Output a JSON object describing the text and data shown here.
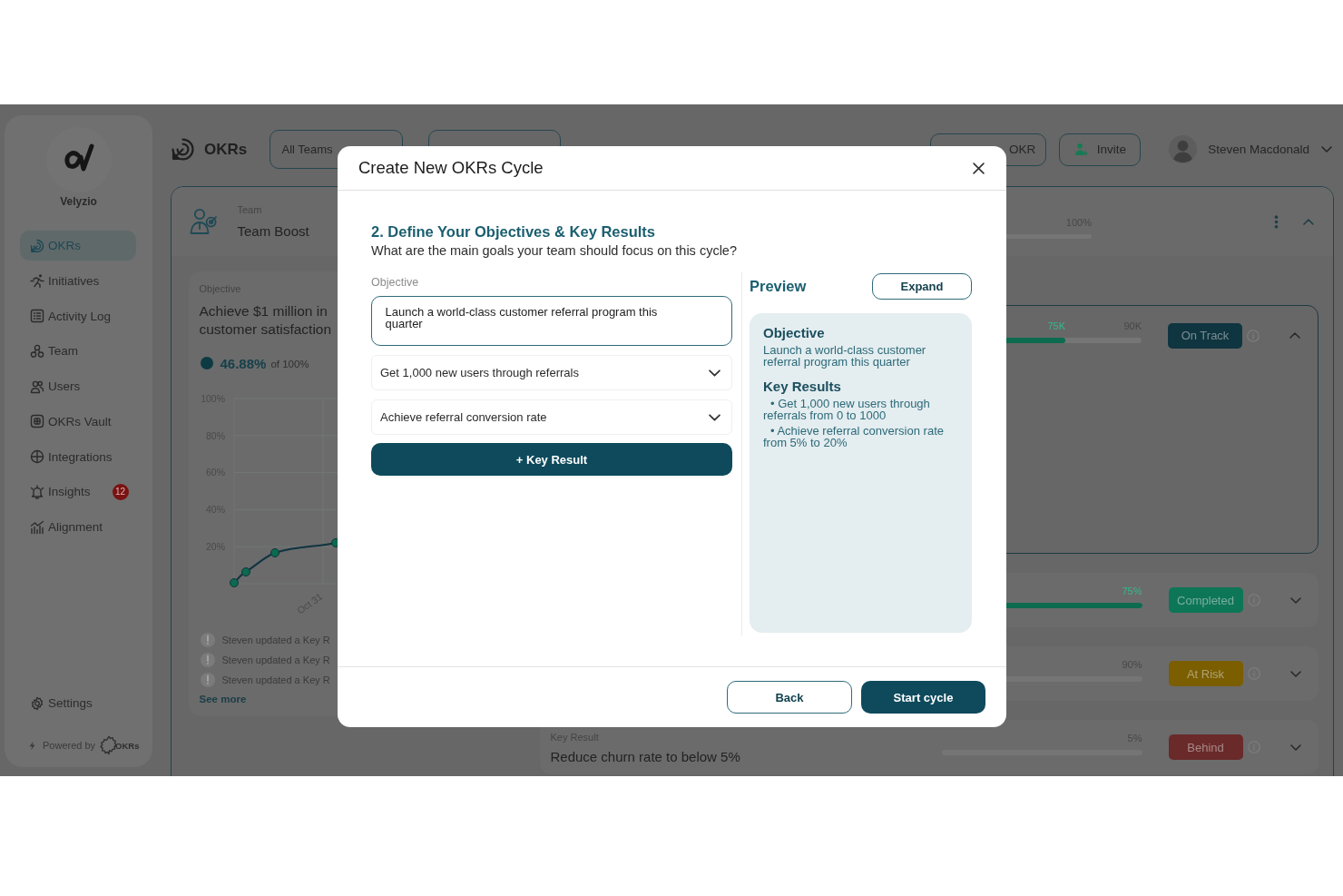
{
  "sidebar": {
    "brand": "Velyzio",
    "items": [
      {
        "label": "OKRs",
        "selected": true
      },
      {
        "label": "Initiatives",
        "selected": false
      },
      {
        "label": "Activity Log",
        "selected": false
      },
      {
        "label": "Team",
        "selected": false
      },
      {
        "label": "Users",
        "selected": false
      },
      {
        "label": "OKRs Vault",
        "selected": false
      },
      {
        "label": "Integrations",
        "selected": false
      },
      {
        "label": "Insights",
        "selected": false,
        "badge": "12"
      },
      {
        "label": "Alignment",
        "selected": false
      }
    ],
    "settings": "Settings",
    "powered_by": "Powered by",
    "powered_logo": "OKRs"
  },
  "header": {
    "title": "OKRs",
    "team_filter": "All Teams",
    "action_button": "OKR",
    "invite_button": "Invite",
    "user_name": "Steven Macdonald"
  },
  "team_card": {
    "label": "Team",
    "name": "Team Boost",
    "reading": "100%",
    "expanded": true
  },
  "objective": {
    "label": "Objective",
    "title_lines": [
      "Achieve $1 million in",
      "customer satisfaction"
    ],
    "progress": "46.88%",
    "progress_of": "of 100%",
    "progress_chart": {
      "y_labels": [
        "100%",
        "80%",
        "60%",
        "40%",
        "20%"
      ],
      "x_labels": [
        "Oct 31"
      ]
    },
    "activity": [
      "Steven updated a Key R",
      "Steven updated a Key R",
      "Steven updated a Key R"
    ],
    "see_more": "See more"
  },
  "key_results": [
    {
      "reading": "75K",
      "target": "90K",
      "level": 0.62,
      "status": "On Track",
      "color": "#0f3540",
      "expanded": true
    },
    {
      "reading": "75%",
      "level": 1,
      "status": "Completed",
      "color": "#0d7656",
      "expanded": false
    },
    {
      "reading": "90%",
      "status": "At Risk",
      "color": "#7a5e00",
      "expanded": false
    },
    {
      "label": "Key Result",
      "title": "Reduce churn rate to below 5%",
      "reading": "5%",
      "status": "Behind",
      "color": "#6a2a2a",
      "expanded": false
    }
  ],
  "modal": {
    "title": "Create New OKRs Cycle",
    "step_title": "2. Define Your Objectives & Key Results",
    "step_subtitle": "What are the main goals your team should focus on this cycle?",
    "objective_label": "Objective",
    "objective_value": "Launch a world-class customer referral program this quarter",
    "key_results": [
      {
        "value": "Get 1,000 new users through referrals",
        "expanded": false
      },
      {
        "value": "Achieve referral conversion rate",
        "expanded": false
      }
    ],
    "add_button": "+ Key Result",
    "preview": {
      "title": "Preview",
      "expand_button": "Expand",
      "objective_heading": "Objective",
      "objective_text": "Launch a world-class customer referral program this quarter",
      "key_results_heading": "Key Results",
      "key_results": [
        "• Get 1,000 new users through referrals from 0 to 1000",
        "• Achieve referral conversion rate from 5% to 20%"
      ]
    },
    "buttons": [
      {
        "label": "Back",
        "kind": "secondary"
      },
      {
        "label": "Start cycle",
        "kind": "primary"
      }
    ]
  }
}
